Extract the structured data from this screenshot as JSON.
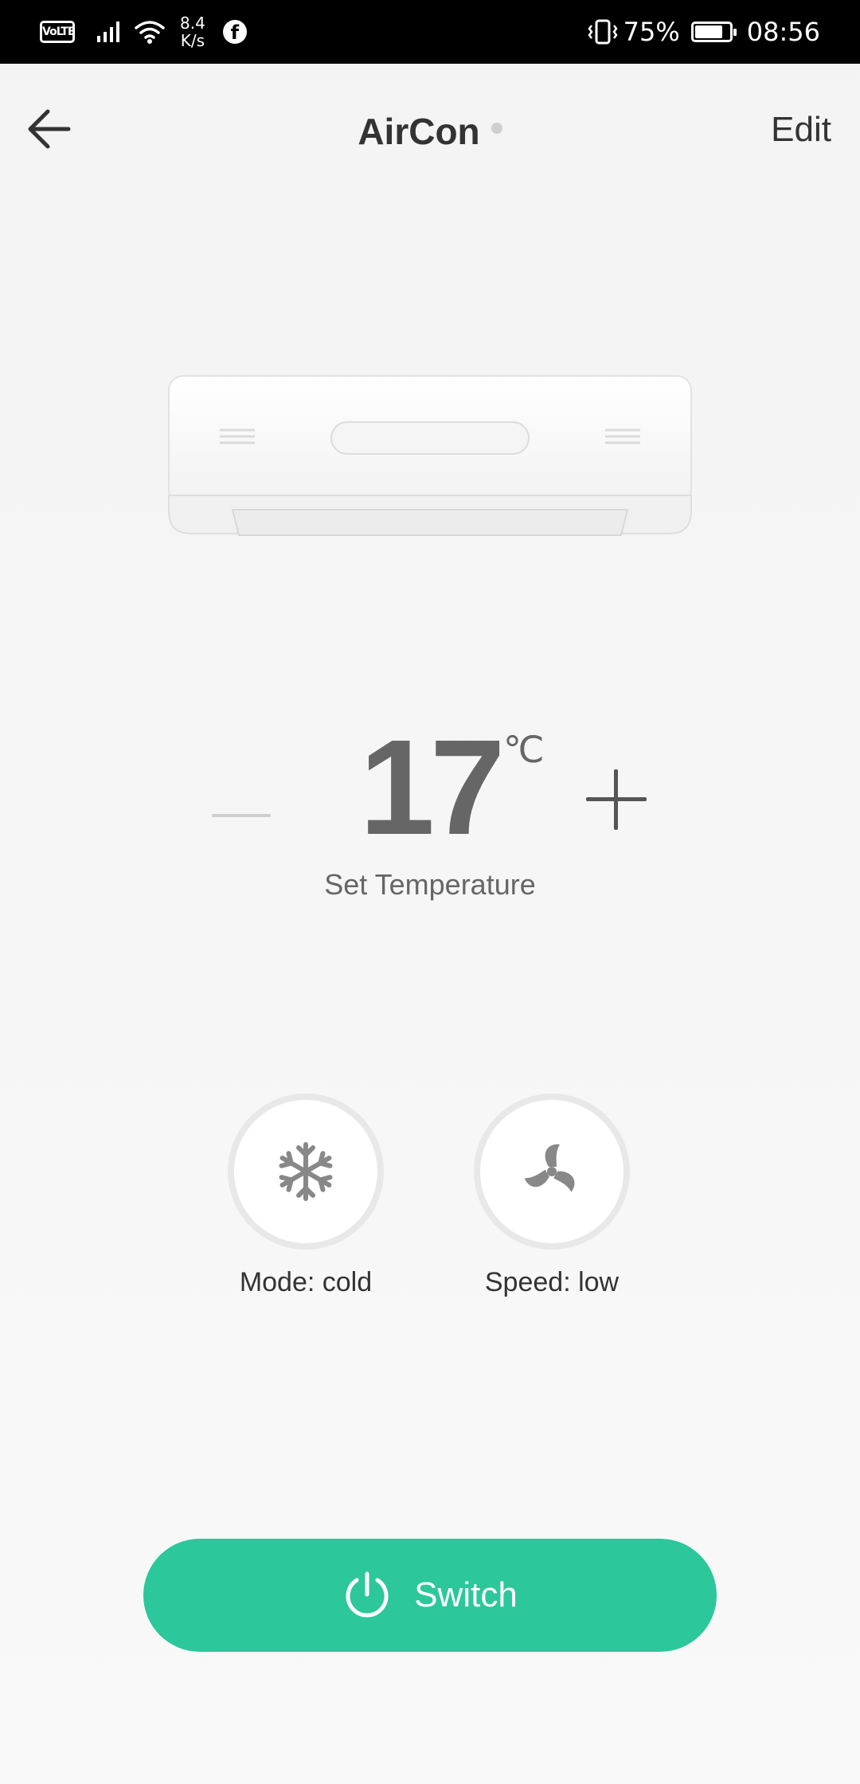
{
  "status_bar": {
    "volte": "VoLTE",
    "net_speed_value": "8.4",
    "net_speed_unit": "K/s",
    "facebook_glyph": "f",
    "battery_percent": "75%",
    "battery_level": 0.75,
    "time": "08:56",
    "icons": [
      "signal-icon",
      "wifi-icon",
      "facebook-icon",
      "vibrate-icon",
      "battery-icon"
    ]
  },
  "header": {
    "title": "AirCon",
    "edit_label": "Edit",
    "back_icon": "arrow-left-icon",
    "status_dot_color": "#cfcfcf"
  },
  "device": {
    "illustration": "air-conditioner-unit"
  },
  "temperature": {
    "value": "17",
    "unit": "℃",
    "label": "Set Temperature",
    "decrease_icon": "minus-icon",
    "increase_icon": "plus-icon"
  },
  "controls": {
    "mode": {
      "label": "Mode: cold",
      "icon": "snowflake-icon"
    },
    "speed": {
      "label": "Speed: low",
      "icon": "fan-icon"
    }
  },
  "switch": {
    "label": "Switch",
    "icon": "power-icon",
    "color": "#2cc79b"
  }
}
